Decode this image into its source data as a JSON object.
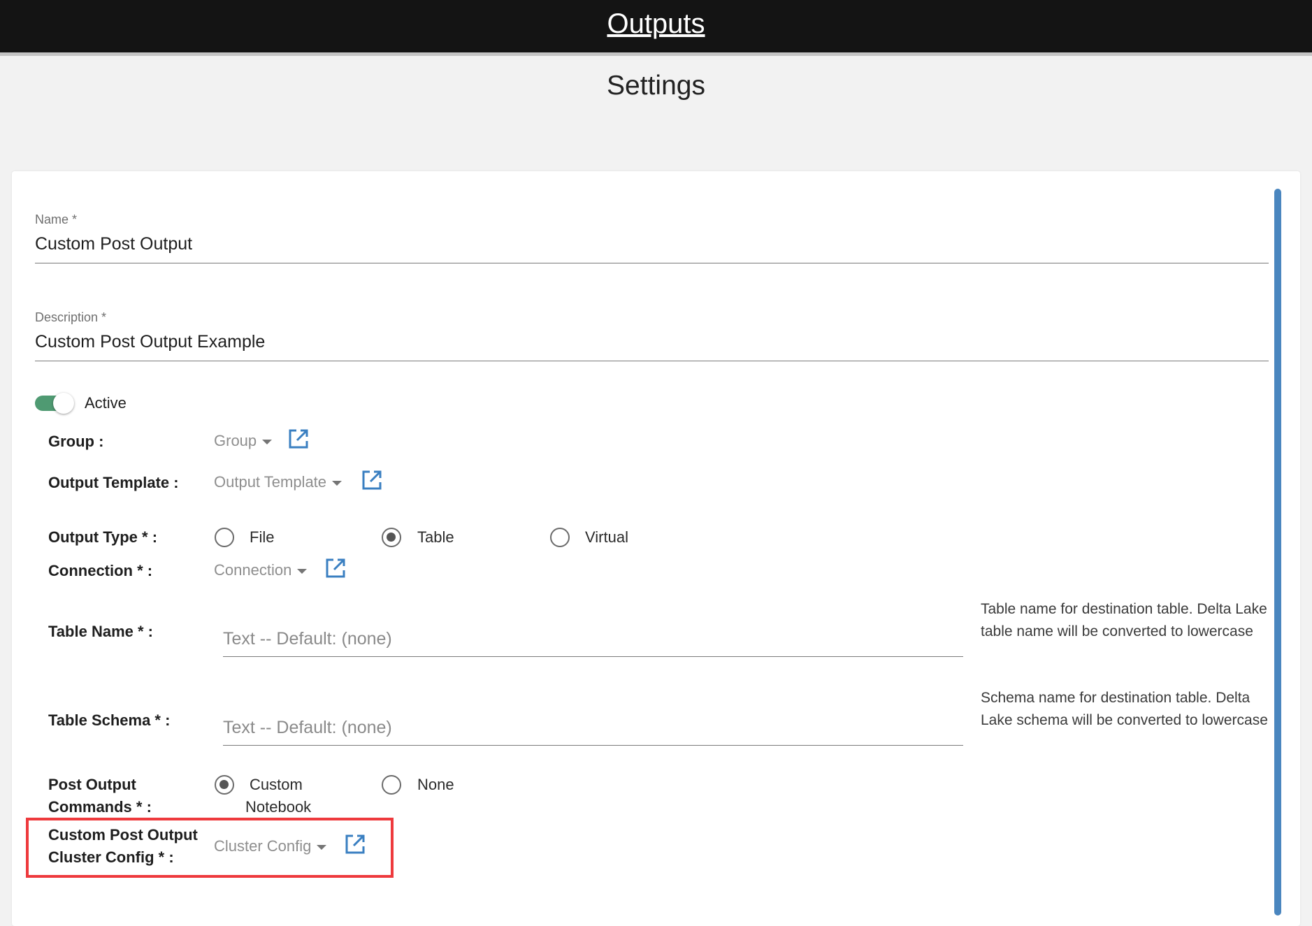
{
  "header": {
    "title": "Outputs"
  },
  "page": {
    "title": "Settings"
  },
  "form": {
    "name": {
      "label": "Name *",
      "value": "Custom Post Output"
    },
    "description": {
      "label": "Description *",
      "value": "Custom Post Output Example"
    },
    "active": {
      "label": "Active",
      "checked": true
    },
    "group": {
      "label": "Group :",
      "placeholder": "Group"
    },
    "output_template": {
      "label": "Output Template :",
      "placeholder": "Output Template"
    },
    "output_type": {
      "label": "Output Type * :",
      "options": [
        "File",
        "Table",
        "Virtual"
      ],
      "selected": "Table"
    },
    "connection": {
      "label": "Connection * :",
      "placeholder": "Connection"
    },
    "table_name": {
      "label": "Table Name * :",
      "placeholder": "Text -- Default: (none)",
      "help": "Table name for destination table. Delta Lake table name will be converted to lowercase"
    },
    "table_schema": {
      "label": "Table Schema * :",
      "placeholder": "Text -- Default: (none)",
      "help": "Schema name for destination table. Delta Lake schema will be converted to lowercase"
    },
    "post_output_commands": {
      "label_line1": "Post Output",
      "label_line2": "Commands * :",
      "options": [
        "Custom Notebook",
        "None"
      ],
      "option_custom_line1": "Custom",
      "option_custom_line2": "Notebook",
      "option_none": "None",
      "selected": "Custom Notebook"
    },
    "custom_post_output_cluster_config": {
      "label_line1": "Custom Post Output",
      "label_line2": "Cluster Config * :",
      "placeholder": "Cluster Config"
    }
  },
  "colors": {
    "header_bg": "#141414",
    "toggle_on": "#4f9a72",
    "link_icon": "#3a7fc1",
    "highlight_border": "#ee3a3d",
    "scrollbar": "#4a86bf"
  },
  "icons": {
    "external_link": "open-in-new-icon"
  }
}
